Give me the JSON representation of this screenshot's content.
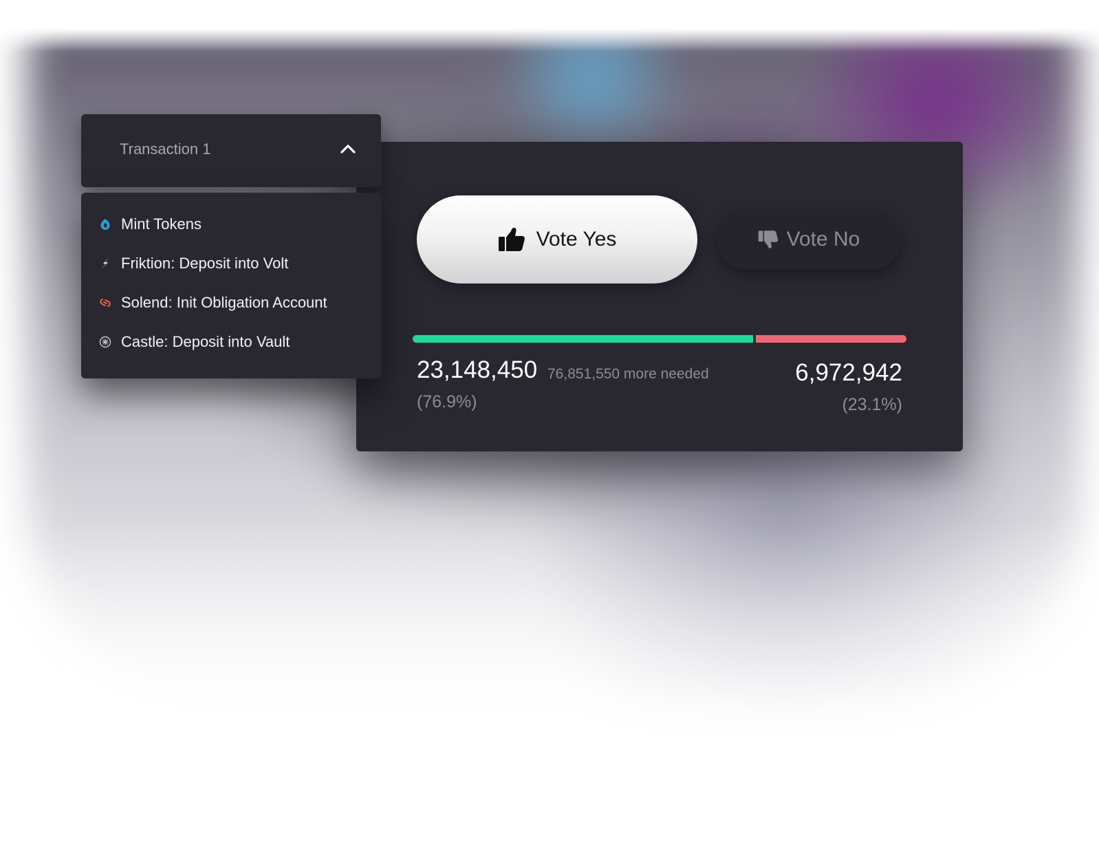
{
  "dropdown": {
    "title": "Transaction 1",
    "expanded": true,
    "items": [
      {
        "label": "Mint Tokens",
        "icon": "mint-tokens-icon",
        "icon_color": "#2d9cdb"
      },
      {
        "label": "Friktion: Deposit into Volt",
        "icon": "friktion-bolt-icon",
        "icon_color": "#e6e6ea"
      },
      {
        "label": "Solend: Init Obligation Account",
        "icon": "solend-icon",
        "icon_color": "#f0643c"
      },
      {
        "label": "Castle: Deposit into Vault",
        "icon": "castle-icon",
        "icon_color": "#c8c8cc"
      }
    ]
  },
  "vote": {
    "yes_label": "Vote Yes",
    "no_label": "Vote No",
    "yes_icon": "thumbs-up-icon",
    "no_icon": "thumbs-down-icon",
    "yes_count": "23,148,450",
    "needed_text": "76,851,550 more needed",
    "yes_pct": "(76.9%)",
    "no_count": "6,972,942",
    "no_pct": "(23.1%)",
    "yes_fraction": 0.689,
    "colors": {
      "yes": "#19dc9c",
      "no": "#ee6873",
      "card": "#292831"
    }
  }
}
